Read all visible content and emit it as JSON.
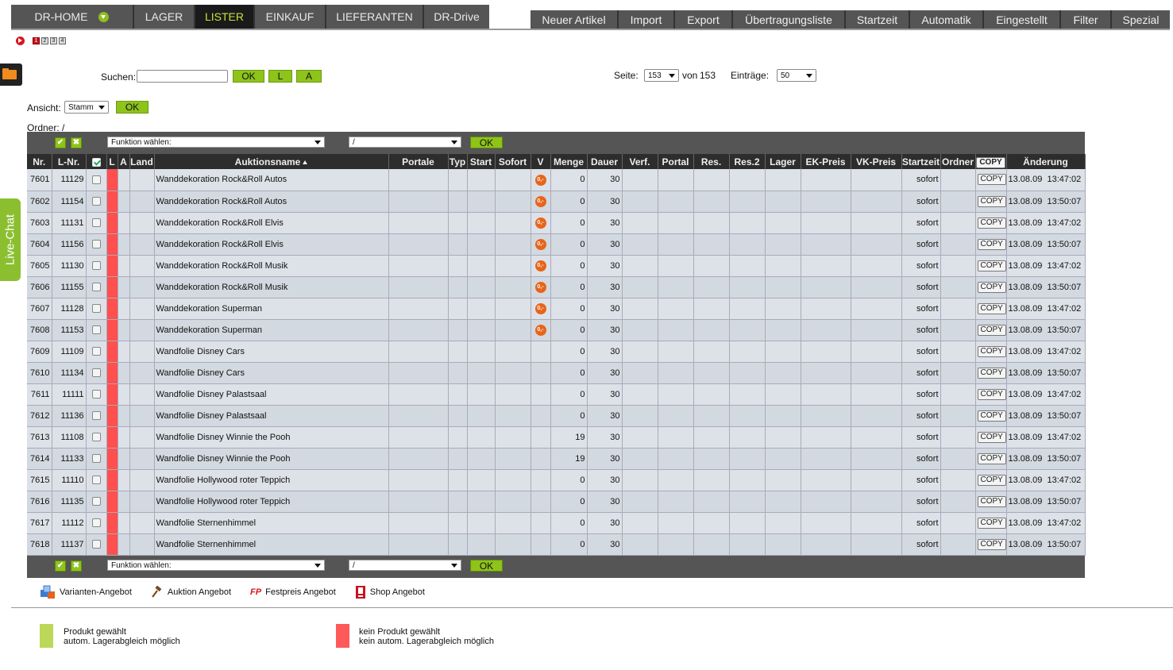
{
  "nav": {
    "main_tabs": [
      {
        "label": "DR-HOME",
        "active": false,
        "dropdown": true
      },
      {
        "label": "LAGER",
        "active": false
      },
      {
        "label": "LISTER",
        "active": true
      },
      {
        "label": "EINKAUF",
        "active": false
      },
      {
        "label": "LIEFERANTEN",
        "active": false
      },
      {
        "label": "DR-Drive",
        "active": false
      }
    ],
    "right_buttons": [
      "Neuer Artikel",
      "Import",
      "Export",
      "Übertragungsliste",
      "Startzeit",
      "Automatik",
      "Eingestellt",
      "Filter",
      "Spezial"
    ]
  },
  "page_indicator": [
    "1",
    "2",
    "3",
    "4"
  ],
  "side": {
    "live_chat": "Live-Chat"
  },
  "search": {
    "label": "Suchen:",
    "value": "",
    "ok": "OK",
    "l": "L",
    "a": "A"
  },
  "paging": {
    "label": "Seite:",
    "current": "153",
    "of_label": "von",
    "total": "153",
    "entries_label": "Einträge:",
    "entries": "50"
  },
  "view": {
    "label": "Ansicht:",
    "value": "Stamm",
    "ok": "OK"
  },
  "folder": {
    "label": "Ordner: /"
  },
  "toolbar": {
    "function_placeholder": "Funktion wählen:",
    "folder_value": "/",
    "ok": "OK",
    "check_all": "✔",
    "uncheck_all": "✖"
  },
  "table": {
    "headers": [
      "Nr.",
      "L-Nr.",
      "",
      "L",
      "A",
      "Land",
      "Auktionsname",
      "Portale",
      "Typ",
      "Start",
      "Sofort",
      "V",
      "Menge",
      "Dauer",
      "Verf.",
      "Portal",
      "Res.",
      "Res.2",
      "Lager",
      "EK-Preis",
      "VK-Preis",
      "Startzeit",
      "Ordner",
      "COPY",
      "Änderung"
    ],
    "badge_text": "0,-",
    "copy_label": "COPY",
    "rows": [
      {
        "nr": "7601",
        "lnr": "11129",
        "name": "Wanddekoration Rock&Roll Autos",
        "badge": true,
        "menge": "0",
        "dauer": "30",
        "startzeit": "sofort",
        "date": "13.08.09",
        "time": "13:47:02"
      },
      {
        "nr": "7602",
        "lnr": "11154",
        "name": "Wanddekoration Rock&Roll Autos",
        "badge": true,
        "menge": "0",
        "dauer": "30",
        "startzeit": "sofort",
        "date": "13.08.09",
        "time": "13:50:07"
      },
      {
        "nr": "7603",
        "lnr": "11131",
        "name": "Wanddekoration Rock&Roll Elvis",
        "badge": true,
        "menge": "0",
        "dauer": "30",
        "startzeit": "sofort",
        "date": "13.08.09",
        "time": "13:47:02"
      },
      {
        "nr": "7604",
        "lnr": "11156",
        "name": "Wanddekoration Rock&Roll Elvis",
        "badge": true,
        "menge": "0",
        "dauer": "30",
        "startzeit": "sofort",
        "date": "13.08.09",
        "time": "13:50:07"
      },
      {
        "nr": "7605",
        "lnr": "11130",
        "name": "Wanddekoration Rock&Roll Musik",
        "badge": true,
        "menge": "0",
        "dauer": "30",
        "startzeit": "sofort",
        "date": "13.08.09",
        "time": "13:47:02"
      },
      {
        "nr": "7606",
        "lnr": "11155",
        "name": "Wanddekoration Rock&Roll Musik",
        "badge": true,
        "menge": "0",
        "dauer": "30",
        "startzeit": "sofort",
        "date": "13.08.09",
        "time": "13:50:07"
      },
      {
        "nr": "7607",
        "lnr": "11128",
        "name": "Wanddekoration Superman",
        "badge": true,
        "menge": "0",
        "dauer": "30",
        "startzeit": "sofort",
        "date": "13.08.09",
        "time": "13:47:02"
      },
      {
        "nr": "7608",
        "lnr": "11153",
        "name": "Wanddekoration Superman",
        "badge": true,
        "menge": "0",
        "dauer": "30",
        "startzeit": "sofort",
        "date": "13.08.09",
        "time": "13:50:07"
      },
      {
        "nr": "7609",
        "lnr": "11109",
        "name": "Wandfolie Disney Cars",
        "badge": false,
        "menge": "0",
        "dauer": "30",
        "startzeit": "sofort",
        "date": "13.08.09",
        "time": "13:47:02"
      },
      {
        "nr": "7610",
        "lnr": "11134",
        "name": "Wandfolie Disney Cars",
        "badge": false,
        "menge": "0",
        "dauer": "30",
        "startzeit": "sofort",
        "date": "13.08.09",
        "time": "13:50:07"
      },
      {
        "nr": "7611",
        "lnr": "11111",
        "name": "Wandfolie Disney Palastsaal",
        "badge": false,
        "menge": "0",
        "dauer": "30",
        "startzeit": "sofort",
        "date": "13.08.09",
        "time": "13:47:02"
      },
      {
        "nr": "7612",
        "lnr": "11136",
        "name": "Wandfolie Disney Palastsaal",
        "badge": false,
        "menge": "0",
        "dauer": "30",
        "startzeit": "sofort",
        "date": "13.08.09",
        "time": "13:50:07"
      },
      {
        "nr": "7613",
        "lnr": "11108",
        "name": "Wandfolie Disney Winnie the Pooh",
        "badge": false,
        "menge": "19",
        "dauer": "30",
        "startzeit": "sofort",
        "date": "13.08.09",
        "time": "13:47:02"
      },
      {
        "nr": "7614",
        "lnr": "11133",
        "name": "Wandfolie Disney Winnie the Pooh",
        "badge": false,
        "menge": "19",
        "dauer": "30",
        "startzeit": "sofort",
        "date": "13.08.09",
        "time": "13:50:07"
      },
      {
        "nr": "7615",
        "lnr": "11110",
        "name": "Wandfolie Hollywood roter Teppich",
        "badge": false,
        "menge": "0",
        "dauer": "30",
        "startzeit": "sofort",
        "date": "13.08.09",
        "time": "13:47:02"
      },
      {
        "nr": "7616",
        "lnr": "11135",
        "name": "Wandfolie Hollywood roter Teppich",
        "badge": false,
        "menge": "0",
        "dauer": "30",
        "startzeit": "sofort",
        "date": "13.08.09",
        "time": "13:50:07"
      },
      {
        "nr": "7617",
        "lnr": "11112",
        "name": "Wandfolie Sternenhimmel",
        "badge": false,
        "menge": "0",
        "dauer": "30",
        "startzeit": "sofort",
        "date": "13.08.09",
        "time": "13:47:02"
      },
      {
        "nr": "7618",
        "lnr": "11137",
        "name": "Wandfolie Sternenhimmel",
        "badge": false,
        "menge": "0",
        "dauer": "30",
        "startzeit": "sofort",
        "date": "13.08.09",
        "time": "13:50:07"
      }
    ]
  },
  "legend": {
    "types": [
      {
        "icon": "variants-icon",
        "label": "Varianten-Angebot"
      },
      {
        "icon": "gavel-icon",
        "label": "Auktion Angebot"
      },
      {
        "icon": "fp-icon",
        "icon_text": "FP",
        "label": "Festpreis Angebot"
      },
      {
        "icon": "shop-icon",
        "label": "Shop Angebot"
      }
    ],
    "status": [
      {
        "color": "#bcd75a",
        "line1": "Produkt gewählt",
        "line2": "autom. Lagerabgleich möglich"
      },
      {
        "color": "#ff5a5a",
        "line1": "kein Produkt gewählt",
        "line2": "kein autom. Lagerabgleich möglich"
      }
    ]
  },
  "colors": {
    "accent_green": "#8ec31a",
    "nav_bg": "#555555",
    "active_tab_text": "#c6e03a",
    "red_marker": "#ff4f4f",
    "badge_orange": "#e8641a"
  }
}
